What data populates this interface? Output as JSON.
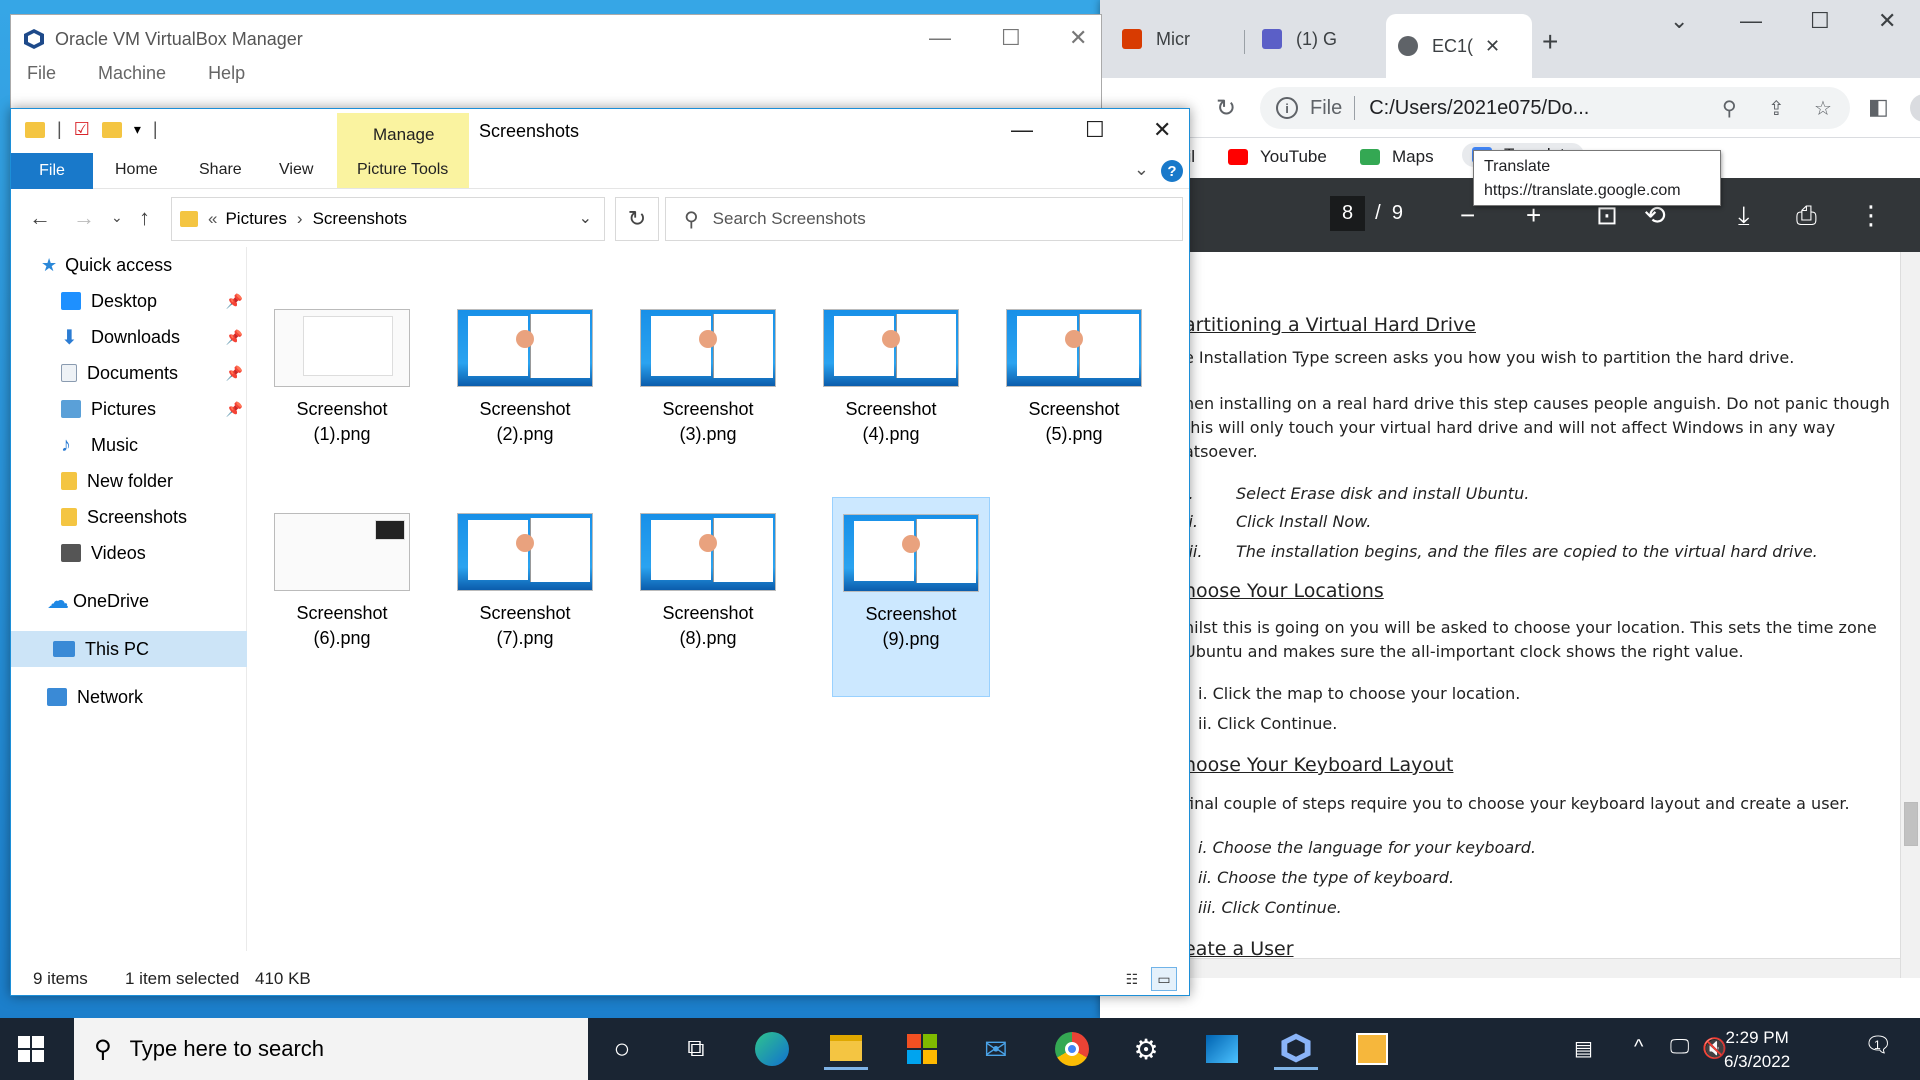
{
  "virtualbox": {
    "title": "Oracle VM VirtualBox Manager",
    "menu": [
      "File",
      "Machine",
      "Help"
    ]
  },
  "chrome": {
    "tabs": [
      {
        "label": "Micr",
        "icon": "office-icon",
        "color": "#d83b01"
      },
      {
        "label": "(1) G",
        "icon": "teams-icon",
        "color": "#5b5fc7"
      },
      {
        "label": "EC1(",
        "icon": "globe-icon",
        "color": "#5f6368"
      }
    ],
    "url_scheme": "File",
    "url": "C:/Users/2021e075/Do...",
    "bookmarks": [
      {
        "label": "ail",
        "color": "#ffffff"
      },
      {
        "label": "YouTube",
        "color": "#ff0000"
      },
      {
        "label": "Maps",
        "color": "#34a853"
      },
      {
        "label": "Translate",
        "color": "#4285f4"
      }
    ],
    "tooltip": {
      "title": "Translate",
      "url": "https://translate.google.com"
    },
    "pdf": {
      "current_page": "8",
      "total_pages": "9",
      "separator": "/",
      "content": {
        "h1": "artitioning a Virtual Hard Drive",
        "p1": "e Installation Type screen asks you how you wish to partition the hard drive.",
        "p2a": "hen installing on a real hard drive this step causes people anguish. Do not panic though",
        "p2b": " this will only touch your virtual hard drive and will not affect Windows in any way",
        "p2c": "atsoever.",
        "l1n": "i.",
        "l1": "Select Erase disk and install Ubuntu.",
        "l2n": "ii.",
        "l2": "Click Install Now.",
        "l3n": "iii.",
        "l3": "The installation begins, and the files are copied to the virtual hard drive.",
        "h2": "hoose Your Locations",
        "p3a": "hilst this is going on you will be asked to choose your location. This sets the time zone",
        "p3b": " Ubuntu and makes sure the all-important clock shows the right value.",
        "l4": "i. Click the map to choose your location.",
        "l5": "ii. Click Continue.",
        "h3": "hoose Your Keyboard Layout",
        "p4": "final couple of steps require you to choose your keyboard layout and create a user.",
        "l6": "i. Choose the language for your keyboard.",
        "l7": "ii. Choose the type of keyboard.",
        "l8": "iii. Click Continue.",
        "h4": "eate a User"
      }
    }
  },
  "explorer": {
    "manage": "Manage",
    "title": "Screenshots",
    "ribbon_tabs": [
      "File",
      "Home",
      "Share",
      "View",
      "Picture Tools"
    ],
    "breadcrumb": [
      "Pictures",
      "Screenshots"
    ],
    "breadcrumb_prefix": "«",
    "search_placeholder": "Search Screenshots",
    "nav": [
      {
        "label": "Quick access",
        "icon": "star-icon",
        "color": "#2b88d8",
        "pinned": false
      },
      {
        "label": "Desktop",
        "icon": "desktop-icon",
        "color": "#1e90ff",
        "pinned": true
      },
      {
        "label": "Downloads",
        "icon": "download-icon",
        "color": "#2b7cd3",
        "pinned": true
      },
      {
        "label": "Documents",
        "icon": "document-icon",
        "color": "#8a9bb0",
        "pinned": true
      },
      {
        "label": "Pictures",
        "icon": "pictures-icon",
        "color": "#5aa0d8",
        "pinned": true
      },
      {
        "label": "Music",
        "icon": "music-icon",
        "color": "#2b7cd3",
        "pinned": false
      },
      {
        "label": "New folder",
        "icon": "folder-icon",
        "color": "#f4c542",
        "pinned": false
      },
      {
        "label": "Screenshots",
        "icon": "folder-icon",
        "color": "#f4c542",
        "pinned": false
      },
      {
        "label": "Videos",
        "icon": "video-icon",
        "color": "#555555",
        "pinned": false
      },
      {
        "label": "OneDrive",
        "icon": "cloud-icon",
        "color": "#1e88e5",
        "pinned": false
      },
      {
        "label": "This PC",
        "icon": "computer-icon",
        "color": "#3a8ad6",
        "pinned": false
      },
      {
        "label": "Network",
        "icon": "network-icon",
        "color": "#3a8ad6",
        "pinned": false
      }
    ],
    "files": [
      {
        "line1": "Screenshot",
        "line2": "(1).png",
        "style": "light"
      },
      {
        "line1": "Screenshot",
        "line2": "(2).png",
        "style": "blue"
      },
      {
        "line1": "Screenshot",
        "line2": "(3).png",
        "style": "blue"
      },
      {
        "line1": "Screenshot",
        "line2": "(4).png",
        "style": "blue"
      },
      {
        "line1": "Screenshot",
        "line2": "(5).png",
        "style": "blue"
      },
      {
        "line1": "Screenshot",
        "line2": "(6).png",
        "style": "light"
      },
      {
        "line1": "Screenshot",
        "line2": "(7).png",
        "style": "blue"
      },
      {
        "line1": "Screenshot",
        "line2": "(8).png",
        "style": "blue"
      },
      {
        "line1": "Screenshot",
        "line2": "(9).png",
        "style": "blue",
        "selected": true
      }
    ],
    "status": {
      "count": "9 items",
      "selected": "1 item selected",
      "size": "410 KB"
    }
  },
  "taskbar": {
    "search_placeholder": "Type here to search",
    "time": "2:29 PM",
    "date": "6/3/2022",
    "notification_count": "1"
  }
}
